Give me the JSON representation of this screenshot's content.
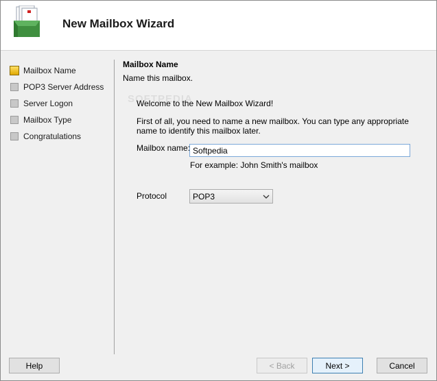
{
  "header": {
    "title": "New Mailbox Wizard",
    "icon": "mailbox-icon"
  },
  "steps": [
    {
      "label": "Mailbox Name",
      "active": true
    },
    {
      "label": "POP3 Server Address",
      "active": false
    },
    {
      "label": "Server Logon",
      "active": false
    },
    {
      "label": "Mailbox Type",
      "active": false
    },
    {
      "label": "Congratulations",
      "active": false
    }
  ],
  "content": {
    "title": "Mailbox Name",
    "subtitle": "Name this mailbox.",
    "welcome": "Welcome to the New Mailbox Wizard!",
    "intro": "First of all, you need to name a new mailbox. You can type any appropriate name to identify this mailbox later.",
    "mailbox_name_label": "Mailbox name:",
    "mailbox_name_value": "Softpedia",
    "mailbox_example": "For example: John Smith's mailbox",
    "protocol_label": "Protocol",
    "protocol_value": "POP3"
  },
  "watermark": "SOFTPEDIA",
  "buttons": {
    "help": "Help",
    "back": "< Back",
    "next": "Next >",
    "cancel": "Cancel"
  },
  "colors": {
    "active_step": "#e0a800",
    "accent_border": "#3c7fb1"
  }
}
